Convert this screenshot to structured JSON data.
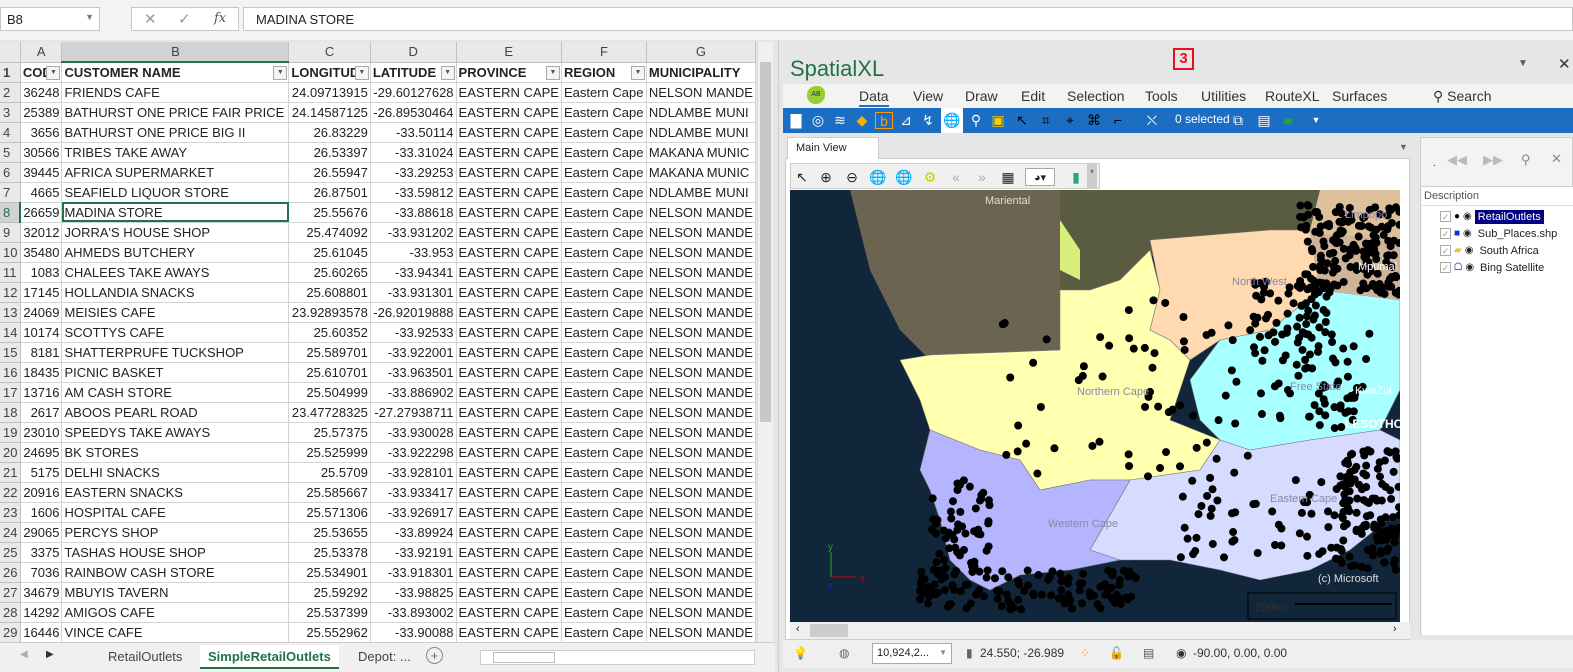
{
  "formula_bar": {
    "name_box": "B8",
    "formula": "MADINA STORE",
    "fx_label": "fx"
  },
  "columns": [
    "A",
    "B",
    "C",
    "D",
    "E",
    "F",
    "G"
  ],
  "header_row": [
    "COD",
    "CUSTOMER NAME",
    "LONGITUD",
    "LATITUDE",
    "PROVINCE",
    "REGION",
    "MUNICIPALITY"
  ],
  "rows": [
    [
      "36248",
      "FRIENDS CAFE",
      "24.09713915",
      "-29.60127628",
      "EASTERN CAPE",
      "Eastern Cape",
      "NELSON MANDE"
    ],
    [
      "25389",
      "BATHURST ONE PRICE FAIR PRICE",
      "24.14587125",
      "-26.89530464",
      "EASTERN CAPE",
      "Eastern Cape",
      "NDLAMBE MUNI"
    ],
    [
      "3656",
      "BATHURST ONE PRICE BIG II",
      "26.83229",
      "-33.50114",
      "EASTERN CAPE",
      "Eastern Cape",
      "NDLAMBE MUNI"
    ],
    [
      "30566",
      "TRIBES TAKE AWAY",
      "26.53397",
      "-33.31024",
      "EASTERN CAPE",
      "Eastern Cape",
      "MAKANA MUNIC"
    ],
    [
      "39445",
      "AFRICA SUPERMARKET",
      "26.55947",
      "-33.29253",
      "EASTERN CAPE",
      "Eastern Cape",
      "MAKANA MUNIC"
    ],
    [
      "4665",
      "SEAFIELD LIQUOR STORE",
      "26.87501",
      "-33.59812",
      "EASTERN CAPE",
      "Eastern Cape",
      "NDLAMBE MUNI"
    ],
    [
      "26659",
      "MADINA STORE",
      "25.55676",
      "-33.88618",
      "EASTERN CAPE",
      "Eastern Cape",
      "NELSON MANDE"
    ],
    [
      "32012",
      "JORRA'S HOUSE SHOP",
      "25.474092",
      "-33.931202",
      "EASTERN CAPE",
      "Eastern Cape",
      "NELSON MANDE"
    ],
    [
      "35480",
      "AHMEDS BUTCHERY",
      "25.61045",
      "-33.953",
      "EASTERN CAPE",
      "Eastern Cape",
      "NELSON MANDE"
    ],
    [
      "1083",
      "CHALEES TAKE AWAYS",
      "25.60265",
      "-33.94341",
      "EASTERN CAPE",
      "Eastern Cape",
      "NELSON MANDE"
    ],
    [
      "17145",
      "HOLLANDIA SNACKS",
      "25.608801",
      "-33.931301",
      "EASTERN CAPE",
      "Eastern Cape",
      "NELSON MANDE"
    ],
    [
      "24069",
      "MEISIES CAFE",
      "23.92893578",
      "-26.92019888",
      "EASTERN CAPE",
      "Eastern Cape",
      "NELSON MANDE"
    ],
    [
      "10174",
      "SCOTTYS CAFE",
      "25.60352",
      "-33.92533",
      "EASTERN CAPE",
      "Eastern Cape",
      "NELSON MANDE"
    ],
    [
      "8181",
      "SHATTERPRUFE TUCKSHOP",
      "25.589701",
      "-33.922001",
      "EASTERN CAPE",
      "Eastern Cape",
      "NELSON MANDE"
    ],
    [
      "18435",
      "PICNIC BASKET",
      "25.610701",
      "-33.963501",
      "EASTERN CAPE",
      "Eastern Cape",
      "NELSON MANDE"
    ],
    [
      "13716",
      "AM CASH STORE",
      "25.504999",
      "-33.886902",
      "EASTERN CAPE",
      "Eastern Cape",
      "NELSON MANDE"
    ],
    [
      "2617",
      "ABOOS PEARL ROAD",
      "23.47728325",
      "-27.27938711",
      "EASTERN CAPE",
      "Eastern Cape",
      "NELSON MANDE"
    ],
    [
      "23010",
      "SPEEDYS TAKE AWAYS",
      "25.57375",
      "-33.930028",
      "EASTERN CAPE",
      "Eastern Cape",
      "NELSON MANDE"
    ],
    [
      "24695",
      "BK STORES",
      "25.525999",
      "-33.922298",
      "EASTERN CAPE",
      "Eastern Cape",
      "NELSON MANDE"
    ],
    [
      "5175",
      "DELHI SNACKS",
      "25.5709",
      "-33.928101",
      "EASTERN CAPE",
      "Eastern Cape",
      "NELSON MANDE"
    ],
    [
      "20916",
      "EASTERN SNACKS",
      "25.585667",
      "-33.933417",
      "EASTERN CAPE",
      "Eastern Cape",
      "NELSON MANDE"
    ],
    [
      "1606",
      "HOSPITAL CAFE",
      "25.571306",
      "-33.926917",
      "EASTERN CAPE",
      "Eastern Cape",
      "NELSON MANDE"
    ],
    [
      "29065",
      "PERCYS SHOP",
      "25.53655",
      "-33.89924",
      "EASTERN CAPE",
      "Eastern Cape",
      "NELSON MANDE"
    ],
    [
      "3375",
      "TASHAS HOUSE SHOP",
      "25.53378",
      "-33.92191",
      "EASTERN CAPE",
      "Eastern Cape",
      "NELSON MANDE"
    ],
    [
      "7036",
      "RAINBOW CASH STORE",
      "25.534901",
      "-33.918301",
      "EASTERN CAPE",
      "Eastern Cape",
      "NELSON MANDE"
    ],
    [
      "34679",
      "MBUYIS TAVERN",
      "25.59292",
      "-33.98825",
      "EASTERN CAPE",
      "Eastern Cape",
      "NELSON MANDE"
    ],
    [
      "14292",
      "AMIGOS CAFE",
      "25.537399",
      "-33.893002",
      "EASTERN CAPE",
      "Eastern Cape",
      "NELSON MANDE"
    ],
    [
      "16446",
      "VINCE CAFE",
      "25.552962",
      "-33.90088",
      "EASTERN CAPE",
      "Eastern Cape",
      "NELSON MANDE"
    ]
  ],
  "sheet_tabs": {
    "items": [
      "RetailOutlets",
      "SimpleRetailOutlets",
      "Depot: ..."
    ],
    "active": "SimpleRetailOutlets"
  },
  "pane": {
    "title": "SpatialXL",
    "badge": "3",
    "menu": [
      "Data",
      "View",
      "Draw",
      "Edit",
      "Selection",
      "Tools",
      "Utilities",
      "RouteXL",
      "Surfaces"
    ],
    "search_label": "Search",
    "active_menu": "Data",
    "selected_count": "0 selected",
    "view_tab": "Main View",
    "map_labels": {
      "mariental": "Mariental",
      "limpopo": "Limpopo",
      "north_west": "North West",
      "mpumalanga": "Mpumal",
      "free_state": "Free State",
      "kwazulu": "KwaZul",
      "lesotho": "LESOTHO",
      "northern_cape": "Northern Cape",
      "western_cape": "Western Cape",
      "eastern_cape": "Eastern Cape",
      "copyright": "(c) Microsoft",
      "scale": "200km",
      "axis_x": "x",
      "axis_y": "y",
      "axis_z": "z"
    },
    "province_colors": {
      "northern_cape": "#ffffb0",
      "western_cape": "#b4b4ff",
      "eastern_cape": "#d6dcff",
      "free_state": "#a8ffff",
      "north_west": "#ffd9b0",
      "ocean": "#12263b"
    },
    "layers_header": "Description",
    "layers": [
      {
        "name": "RetailOutlets",
        "icon": "point-icon",
        "selected": true,
        "checked": true
      },
      {
        "name": "Sub_Places.shp",
        "icon": "polygon-icon",
        "selected": false,
        "checked": true
      },
      {
        "name": "South Africa",
        "icon": "folder-icon",
        "selected": false,
        "checked": true
      },
      {
        "name": "Bing Satellite",
        "icon": "bing-icon",
        "selected": false,
        "checked": true
      }
    ],
    "status": {
      "scale_value": "10,924,2...",
      "coords": "24.550; -26.989",
      "rotation": "-90.00, 0.00, 0.00"
    }
  }
}
